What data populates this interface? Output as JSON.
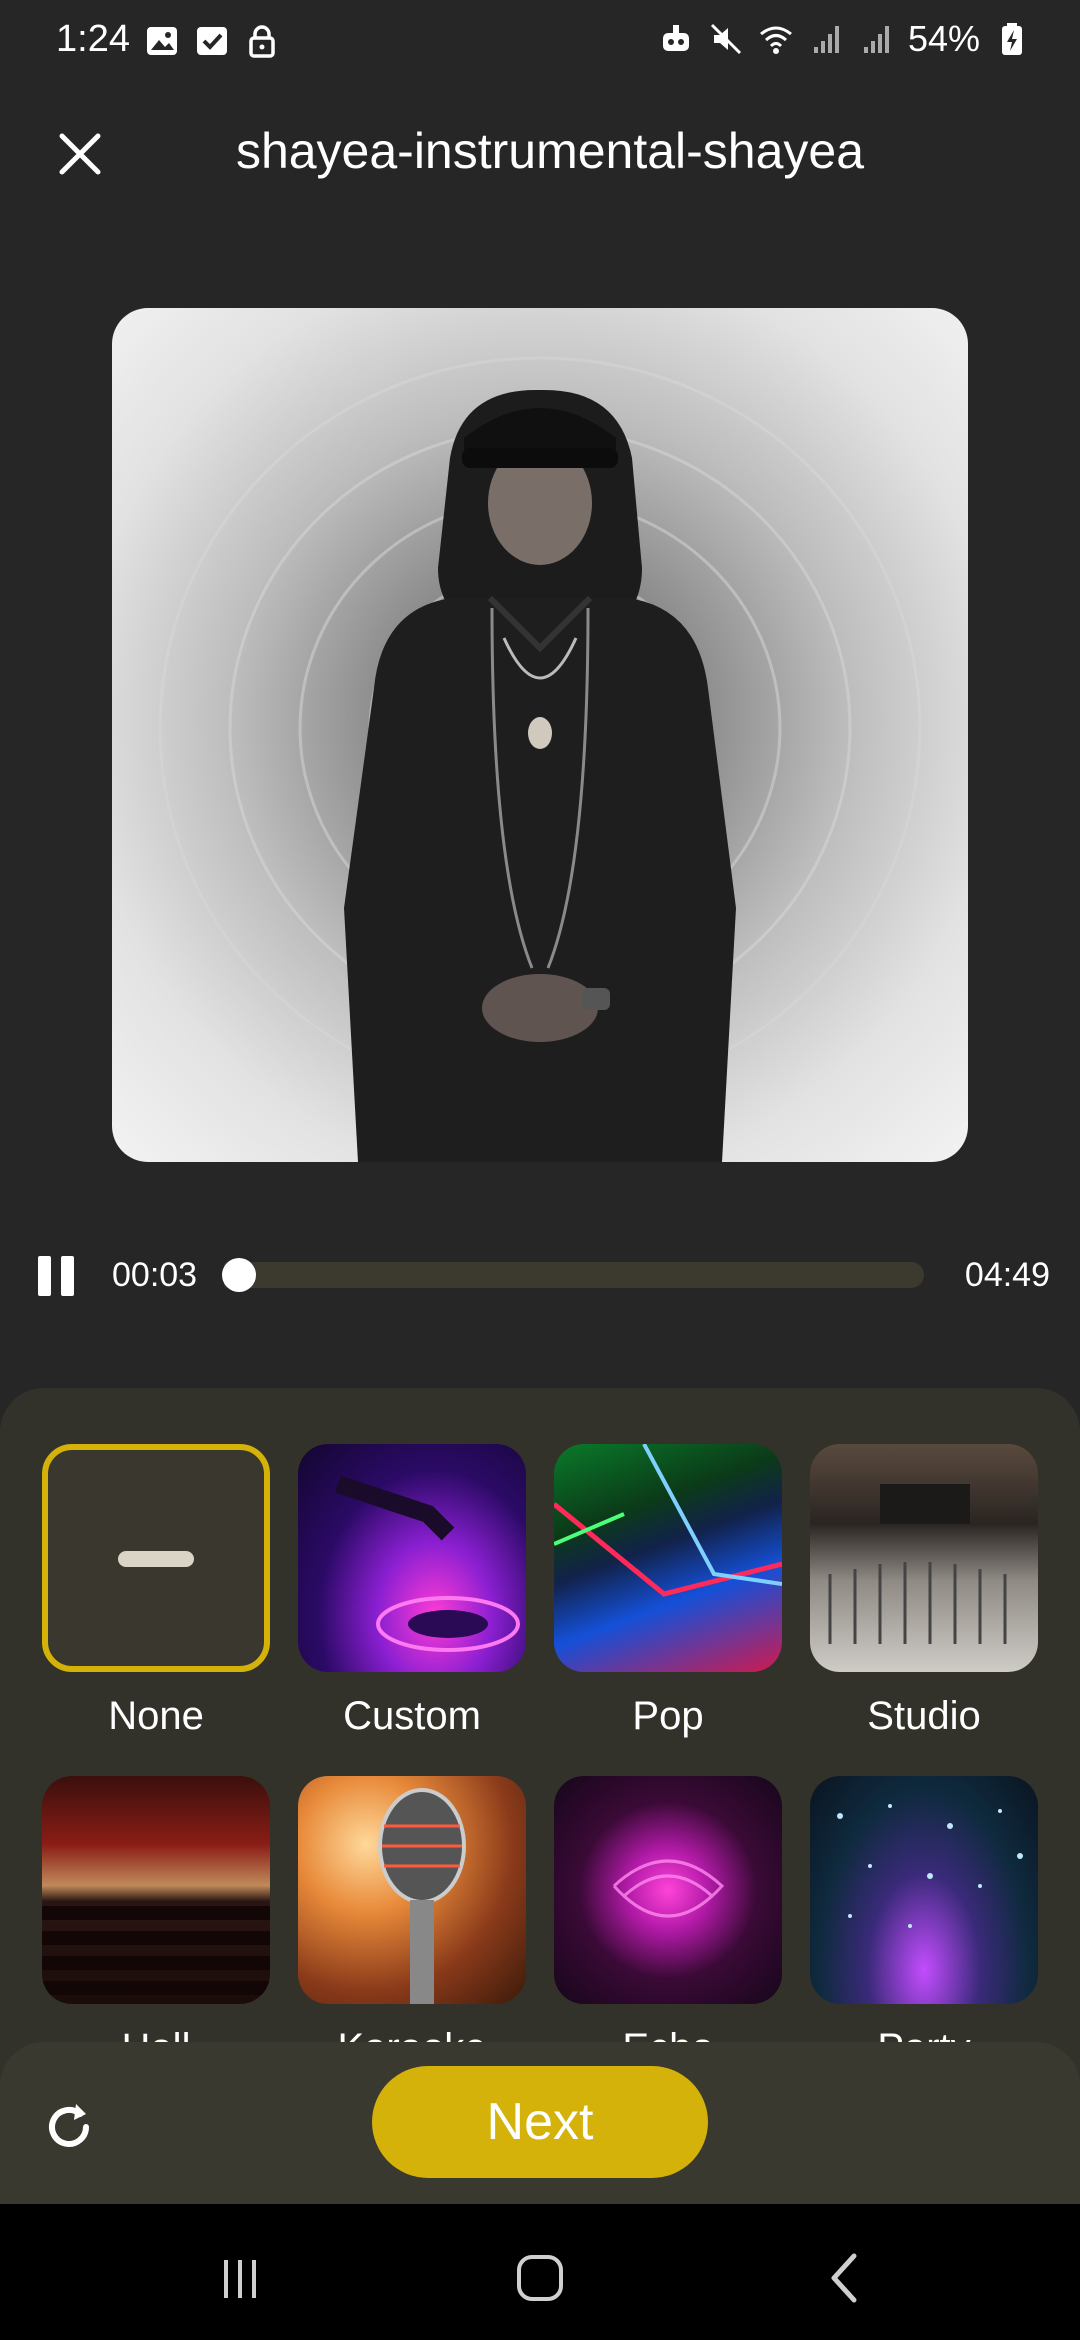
{
  "status_bar": {
    "time": "1:24",
    "battery_percent": "54%",
    "left_icons": [
      "image-icon",
      "checkbox-icon",
      "lock-icon"
    ],
    "right_icons": [
      "robot-icon",
      "mute-icon",
      "wifi-icon",
      "signal-icon",
      "signal-icon",
      "battery-charging-icon"
    ]
  },
  "header": {
    "title": "shayea-instrumental-shayea",
    "close_icon": "close-icon"
  },
  "player": {
    "current_time": "00:03",
    "total_time": "04:49",
    "progress": 0.011,
    "state_icon": "pause-icon"
  },
  "presets": [
    {
      "label": "None",
      "selected": true
    },
    {
      "label": "Custom",
      "selected": false
    },
    {
      "label": "Pop",
      "selected": false
    },
    {
      "label": "Studio",
      "selected": false
    },
    {
      "label": "Hall",
      "selected": false
    },
    {
      "label": "Karaoke",
      "selected": false
    },
    {
      "label": "Echo",
      "selected": false
    },
    {
      "label": "Party",
      "selected": false
    }
  ],
  "bottom_bar": {
    "next_label": "Next",
    "reset_icon": "refresh-icon"
  },
  "nav_bar": {
    "icons": [
      "recent-apps-icon",
      "home-icon",
      "back-icon"
    ]
  },
  "colors": {
    "background": "#262626",
    "accent": "#d4b20a",
    "sheet": "#33322a",
    "progress_track": "#3c3a2f"
  }
}
